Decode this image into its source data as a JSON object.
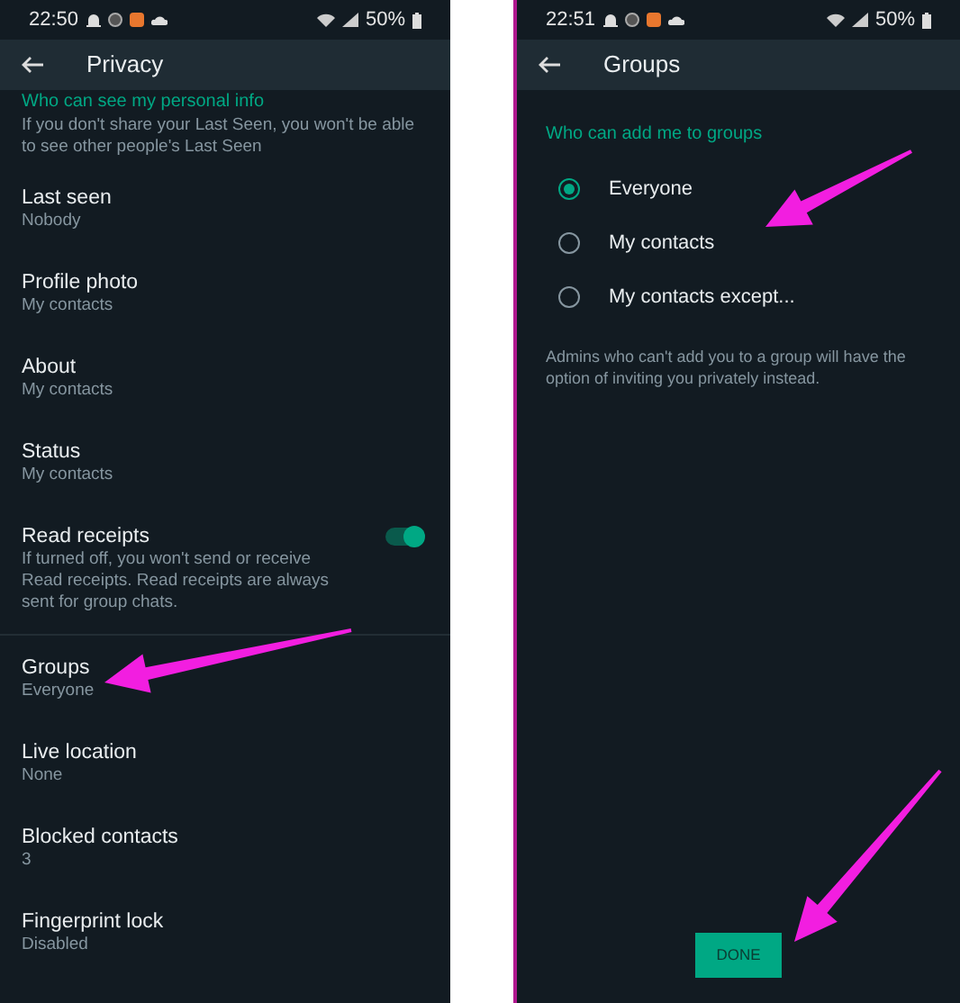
{
  "screens": [
    {
      "status_bar": {
        "time": "22:50",
        "battery": "50%"
      },
      "title": "Privacy",
      "section_header": "Who can see my personal info",
      "section_note": "If you don't share your Last Seen, you won't be able to see other people's Last Seen",
      "items": [
        {
          "kind": "setting",
          "label": "Last seen",
          "value": "Nobody"
        },
        {
          "kind": "setting",
          "label": "Profile photo",
          "value": "My contacts"
        },
        {
          "kind": "setting",
          "label": "About",
          "value": "My contacts"
        },
        {
          "kind": "setting",
          "label": "Status",
          "value": "My contacts"
        },
        {
          "kind": "toggle",
          "label": "Read receipts",
          "value": "If turned off, you won't send or receive Read receipts. Read receipts are always sent for group chats.",
          "on": true
        },
        {
          "kind": "divider"
        },
        {
          "kind": "setting",
          "label": "Groups",
          "value": "Everyone"
        },
        {
          "kind": "setting",
          "label": "Live location",
          "value": "None"
        },
        {
          "kind": "setting",
          "label": "Blocked contacts",
          "value": "3"
        },
        {
          "kind": "setting",
          "label": "Fingerprint lock",
          "value": "Disabled"
        }
      ]
    },
    {
      "status_bar": {
        "time": "22:51",
        "battery": "50%"
      },
      "title": "Groups",
      "section_header": "Who can add me to groups",
      "options": [
        {
          "label": "Everyone",
          "selected": true
        },
        {
          "label": "My contacts",
          "selected": false
        },
        {
          "label": "My contacts except...",
          "selected": false
        }
      ],
      "note": "Admins who can't add you to a group will have the option of inviting you privately instead.",
      "button": "DONE"
    }
  ]
}
